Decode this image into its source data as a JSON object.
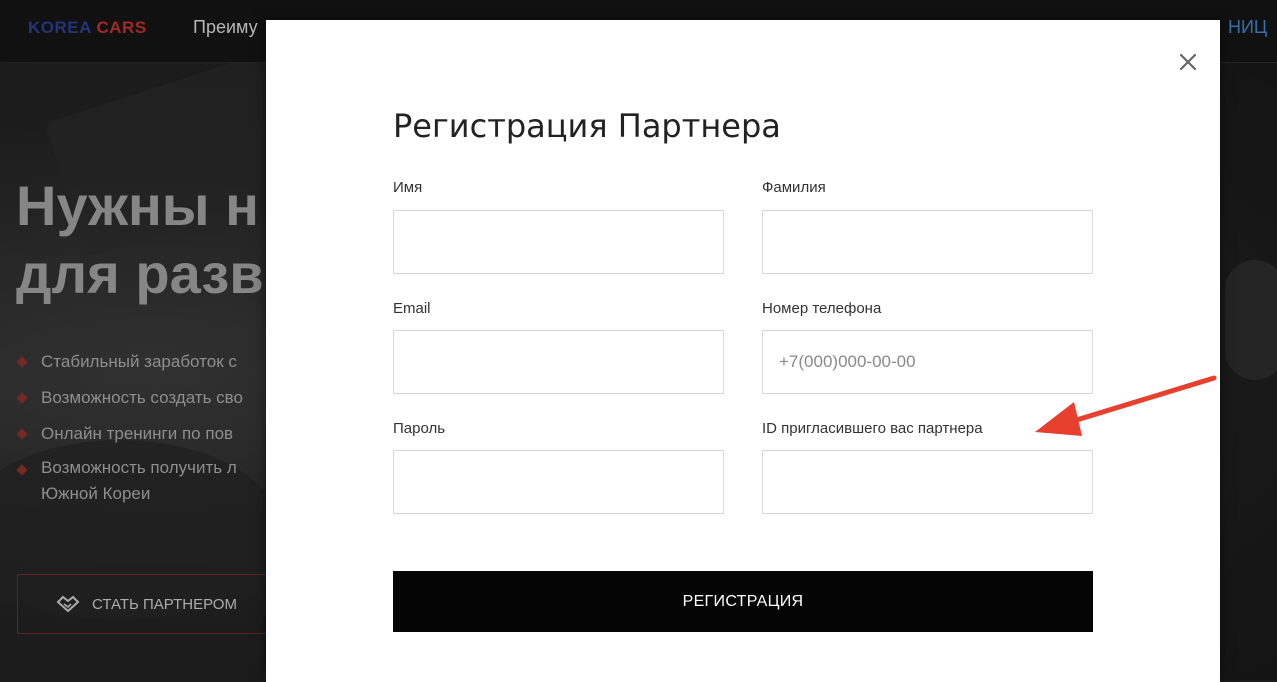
{
  "background": {
    "logo": {
      "part1": "KOREA",
      "part2": "CARS"
    },
    "nav": {
      "item1": "Преиму",
      "right": "НИЦ"
    },
    "hero": {
      "line1": "Нужны н",
      "line2": "для разв"
    },
    "bullets": [
      "Стабильный заработок с",
      "Возможность создать сво",
      "Онлайн тренинги по пов",
      "Возможность получить л"
    ],
    "bullet_continuation": "Южной Кореи",
    "partner_button": {
      "label": "СТАТЬ ПАРТНЕРОМ",
      "icon": "handshake-icon"
    }
  },
  "modal": {
    "title": "Регистрация Партнера",
    "close_icon": "close-icon",
    "fields": {
      "first_name": {
        "label": "Имя",
        "value": "",
        "placeholder": ""
      },
      "last_name": {
        "label": "Фамилия",
        "value": "",
        "placeholder": ""
      },
      "email": {
        "label": "Email",
        "value": "",
        "placeholder": ""
      },
      "phone": {
        "label": "Номер телефона",
        "value": "",
        "placeholder": "+7(000)000-00-00"
      },
      "password": {
        "label": "Пароль",
        "value": "",
        "placeholder": ""
      },
      "referrer_id": {
        "label": "ID пригласившего вас партнера",
        "value": "",
        "placeholder": ""
      }
    },
    "submit_label": "РЕГИСТРАЦИЯ"
  },
  "annotation": {
    "icon": "red-arrow-icon",
    "color": "#e8402f"
  },
  "colors": {
    "accent_red": "#c0312f",
    "button_bg": "#050505",
    "modal_bg": "#ffffff"
  }
}
